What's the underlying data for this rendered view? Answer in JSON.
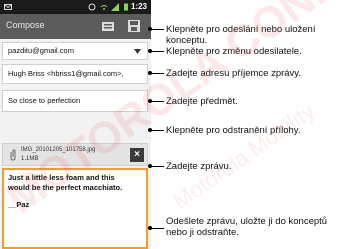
{
  "status": {
    "time": "1:23"
  },
  "header": {
    "title": "Compose"
  },
  "compose": {
    "from": "pazditu@gmail.com",
    "to": "Hugh Briss <hbriss1@gmail.com>,",
    "subject": "So close to perfection",
    "attachment": {
      "name": "IMG_20101205_101758.jpg",
      "size": "1.1MB"
    },
    "body_line1": "Just a little less foam and this",
    "body_line2": "would be the perfect macchiato.",
    "signature": "__Paz"
  },
  "callouts": {
    "send_save_line1": "Klepněte pro odeslání nebo uložení",
    "send_save_line2": "konceptu.",
    "sender": "Klepněte pro změnu odesilatele.",
    "recipient": "Zadejte adresu příjemce zprávy.",
    "subject": "Zadejte předmět.",
    "remove_attachment": "Klepněte pro odstranění přílohy.",
    "message": "Zadejte zprávu.",
    "bottom_line1": "Odešlete zprávu, uložte ji do konceptů",
    "bottom_line2": "nebo ji odstraňte."
  },
  "watermark": {
    "text": "MOTOROLA CONFIDENTIAL",
    "text2": "Motorola Mobility"
  },
  "colors": {
    "accent": "#f39c2a",
    "titlebar": "#5c5c5c",
    "statusbar": "#1a1a1a"
  }
}
